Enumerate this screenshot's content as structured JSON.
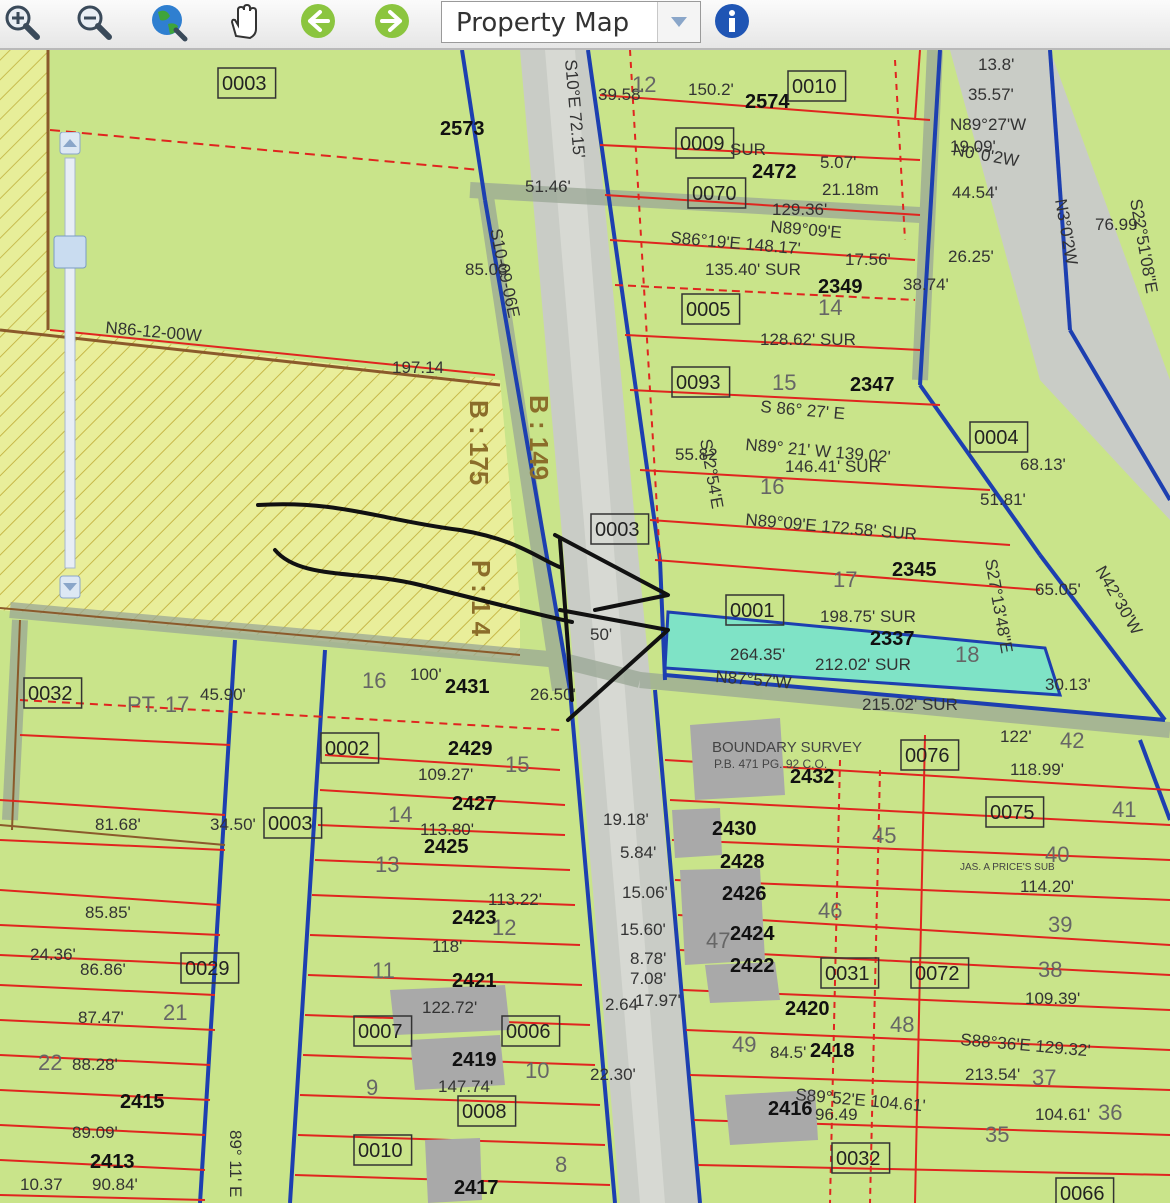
{
  "toolbar": {
    "layer_select_value": "Property Map",
    "icons": [
      "zoom-in-icon",
      "zoom-out-icon",
      "globe-icon",
      "hand-pan-icon",
      "back-arrow-icon",
      "forward-arrow-icon",
      "dropdown-arrow-icon",
      "info-icon"
    ]
  },
  "map": {
    "highlight_color": "#7fe3c6",
    "lot_fill": "#c9e48a",
    "line_red": "#e0251f",
    "line_blue": "#1d3fb0",
    "addresses": [
      "2573",
      "2574",
      "2472",
      "2349",
      "2347",
      "2345",
      "2337",
      "2431",
      "2429",
      "2427",
      "2425",
      "2423",
      "2421",
      "2419",
      "2417",
      "2415",
      "2413",
      "2432",
      "2430",
      "2428",
      "2426",
      "2424",
      "2422",
      "2420",
      "2418",
      "2416"
    ],
    "parcel_ids": [
      "0003",
      "0010",
      "0009",
      "0070",
      "0005",
      "0093",
      "0004",
      "0001",
      "0003",
      "0076",
      "0075",
      "0002",
      "0032",
      "0003",
      "0029",
      "0007",
      "0006",
      "0008",
      "0010",
      "0031",
      "0072",
      "0032",
      "0066"
    ],
    "block_labels": [
      "B : 175",
      "P : 1 4",
      "B : 149"
    ],
    "bearings": [
      "N86-12-00W",
      "S10°E 72.15'",
      "S10-09-06E",
      "N89°09'E",
      "S86°19'E 148.17'",
      "N0°0'2W",
      "N3°0'2W",
      "N89°27'W",
      "S22°51'08\"E",
      "S12°54'E",
      "N89°09'E 172.58' SUR",
      "N89° 21' W 139.02'",
      "S 86° 27' E",
      "N42°30'W",
      "S27°13'48\"E",
      "N87°57'W",
      "S88°36'E 129.32'",
      "S89°52'E 104.61'",
      "89° 11' E"
    ],
    "measurements": [
      "13.8'",
      "35.57'",
      "19.09'",
      "44.54'",
      "26.25'",
      "150.2'",
      "5.07'",
      "21.18m",
      "129.36'",
      "17.56'",
      "135.40' SUR",
      "128.62' SUR",
      "146.41' SUR",
      "198.75' SUR",
      "264.35'",
      "212.02' SUR",
      "215.02' SUR",
      "197.14",
      "51.46'",
      "85.03",
      "39.58'",
      "55.82",
      "50'",
      "100'",
      "26.50'",
      "109.27'",
      "113.80'",
      "113.22'",
      "118'",
      "122.72'",
      "147.74'",
      "81.68'",
      "85.85'",
      "86.86'",
      "87.47'",
      "88.28'",
      "89.09'",
      "90.84'",
      "45.90'",
      "34.50'",
      "24.36'",
      "10.37",
      "19.18'",
      "5.84'",
      "15.06'",
      "15.60'",
      "8.78'",
      "7.08'",
      "17.97'",
      "84.5'",
      "96.49",
      "122'",
      "118.99'",
      "114.20'",
      "109.39'",
      "213.54'",
      "104.61'",
      "51.81'",
      "68.13'",
      "38.74'",
      "76.99'",
      "30.13'",
      "65.05'",
      "2.64'",
      "22.30'"
    ],
    "lot_numbers": [
      "12",
      "14",
      "15",
      "16",
      "17",
      "18",
      "15",
      "14",
      "13",
      "12",
      "11",
      "10",
      "9",
      "8",
      "21",
      "22",
      "16",
      "45",
      "46",
      "47",
      "48",
      "49",
      "41",
      "42",
      "40",
      "39",
      "38",
      "37",
      "36",
      "35"
    ],
    "notes": [
      "BOUNDARY SURVEY",
      "P.B. 471 PG. 92 C.O.",
      "JAS. A PRICE'S SUB",
      "PT. 17",
      "SUR"
    ]
  }
}
